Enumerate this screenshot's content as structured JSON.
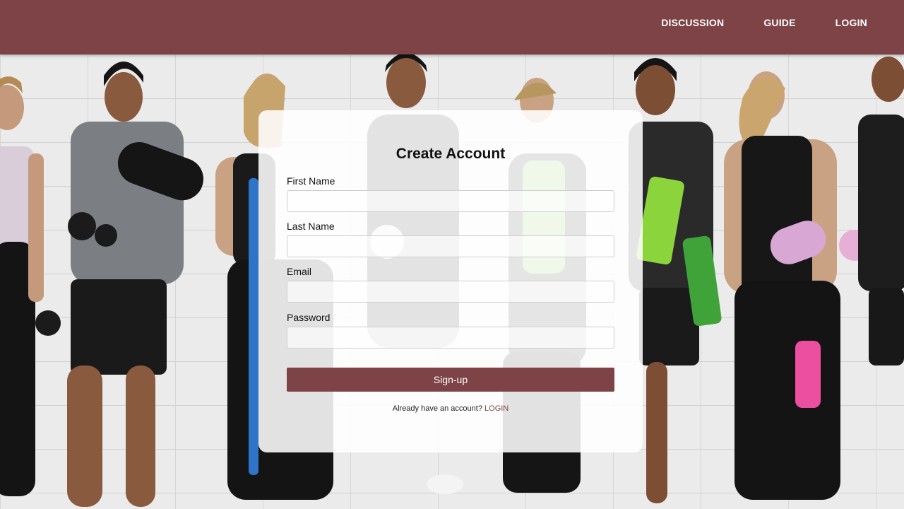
{
  "nav": {
    "items": [
      {
        "label": "DISCUSSION"
      },
      {
        "label": "GUIDE"
      },
      {
        "label": "LOGIN"
      }
    ]
  },
  "form": {
    "title": "Create Account",
    "fields": [
      {
        "label": "First Name",
        "value": "",
        "placeholder": ""
      },
      {
        "label": "Last Name",
        "value": "",
        "placeholder": ""
      },
      {
        "label": "Email",
        "value": "",
        "placeholder": ""
      },
      {
        "label": "Password",
        "value": "",
        "placeholder": ""
      }
    ],
    "submit_label": "Sign-up",
    "footer_text": "Already have an account?",
    "footer_link": "LOGIN"
  },
  "colors": {
    "brand": "#7d4346",
    "card_background": "#ffffff",
    "wall": "#ebebeb"
  },
  "hero": {
    "description_icon": "fitness-people-photo"
  }
}
